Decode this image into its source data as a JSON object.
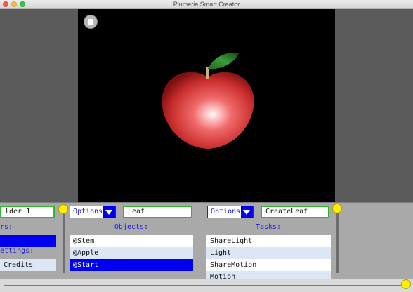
{
  "window": {
    "title": "Plumeria Smart Creator"
  },
  "viewport": {
    "pause_icon": "pause-icon",
    "object": "apple"
  },
  "left_panel": {
    "field_value": "lder 1",
    "header1": "rs:",
    "header2": "ettings:",
    "rows": [
      {
        "label": "",
        "selected": true
      },
      {
        "label": "Credits",
        "selected": false
      }
    ]
  },
  "objects_panel": {
    "options_label": "Options",
    "field_value": "Leaf",
    "header": "Objects:",
    "rows": [
      {
        "label": "@Stem",
        "selected": false
      },
      {
        "label": "@Apple",
        "selected": false
      },
      {
        "label": "@Start",
        "selected": true
      }
    ]
  },
  "tasks_panel": {
    "options_label": "Options",
    "field_value": "CreateLeaf",
    "header": "Tasks:",
    "rows": [
      {
        "label": "ShareLight",
        "selected": false
      },
      {
        "label": "Light",
        "selected": false
      },
      {
        "label": "ShareMotion",
        "selected": false
      },
      {
        "label": "Motion",
        "selected": false
      }
    ]
  },
  "sliders": {
    "left_vertical_value": 0,
    "right_vertical_value": 0,
    "bottom_horizontal_value": 1
  },
  "colors": {
    "accent_blue": "#0000ee",
    "field_border_green": "#2fb52f",
    "slider_knob_yellow": "#ffee00",
    "alt_row": "#dde6f5"
  }
}
